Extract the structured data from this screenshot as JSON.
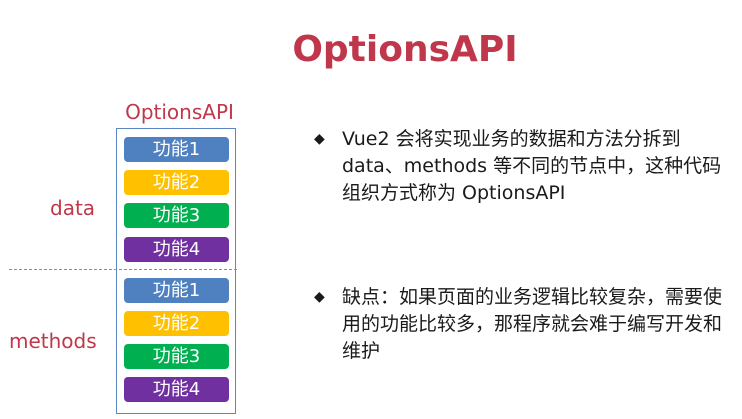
{
  "title": "OptionsAPI",
  "diagram": {
    "label": "OptionsAPI",
    "data_label": "data",
    "methods_label": "methods",
    "data_items": [
      {
        "label": "功能1",
        "color": "#4f80c0"
      },
      {
        "label": "功能2",
        "color": "#ffc000"
      },
      {
        "label": "功能3",
        "color": "#00b050"
      },
      {
        "label": "功能4",
        "color": "#7030a0"
      }
    ],
    "methods_items": [
      {
        "label": "功能1",
        "color": "#4f80c0"
      },
      {
        "label": "功能2",
        "color": "#ffc000"
      },
      {
        "label": "功能3",
        "color": "#00b050"
      },
      {
        "label": "功能4",
        "color": "#7030a0"
      }
    ]
  },
  "bullets": [
    {
      "marker": "◆",
      "text": "Vue2 会将实现业务的数据和方法分拆到data、methods 等不同的节点中，这种代码组织方式称为 OptionsAPI"
    },
    {
      "marker": "◆",
      "text": "缺点：如果页面的业务逻辑比较复杂，需要使用的功能比较多，那程序就会难于编写开发和维护"
    }
  ],
  "colors": {
    "accent": "#c0374b",
    "box_border": "#5b86c4"
  }
}
